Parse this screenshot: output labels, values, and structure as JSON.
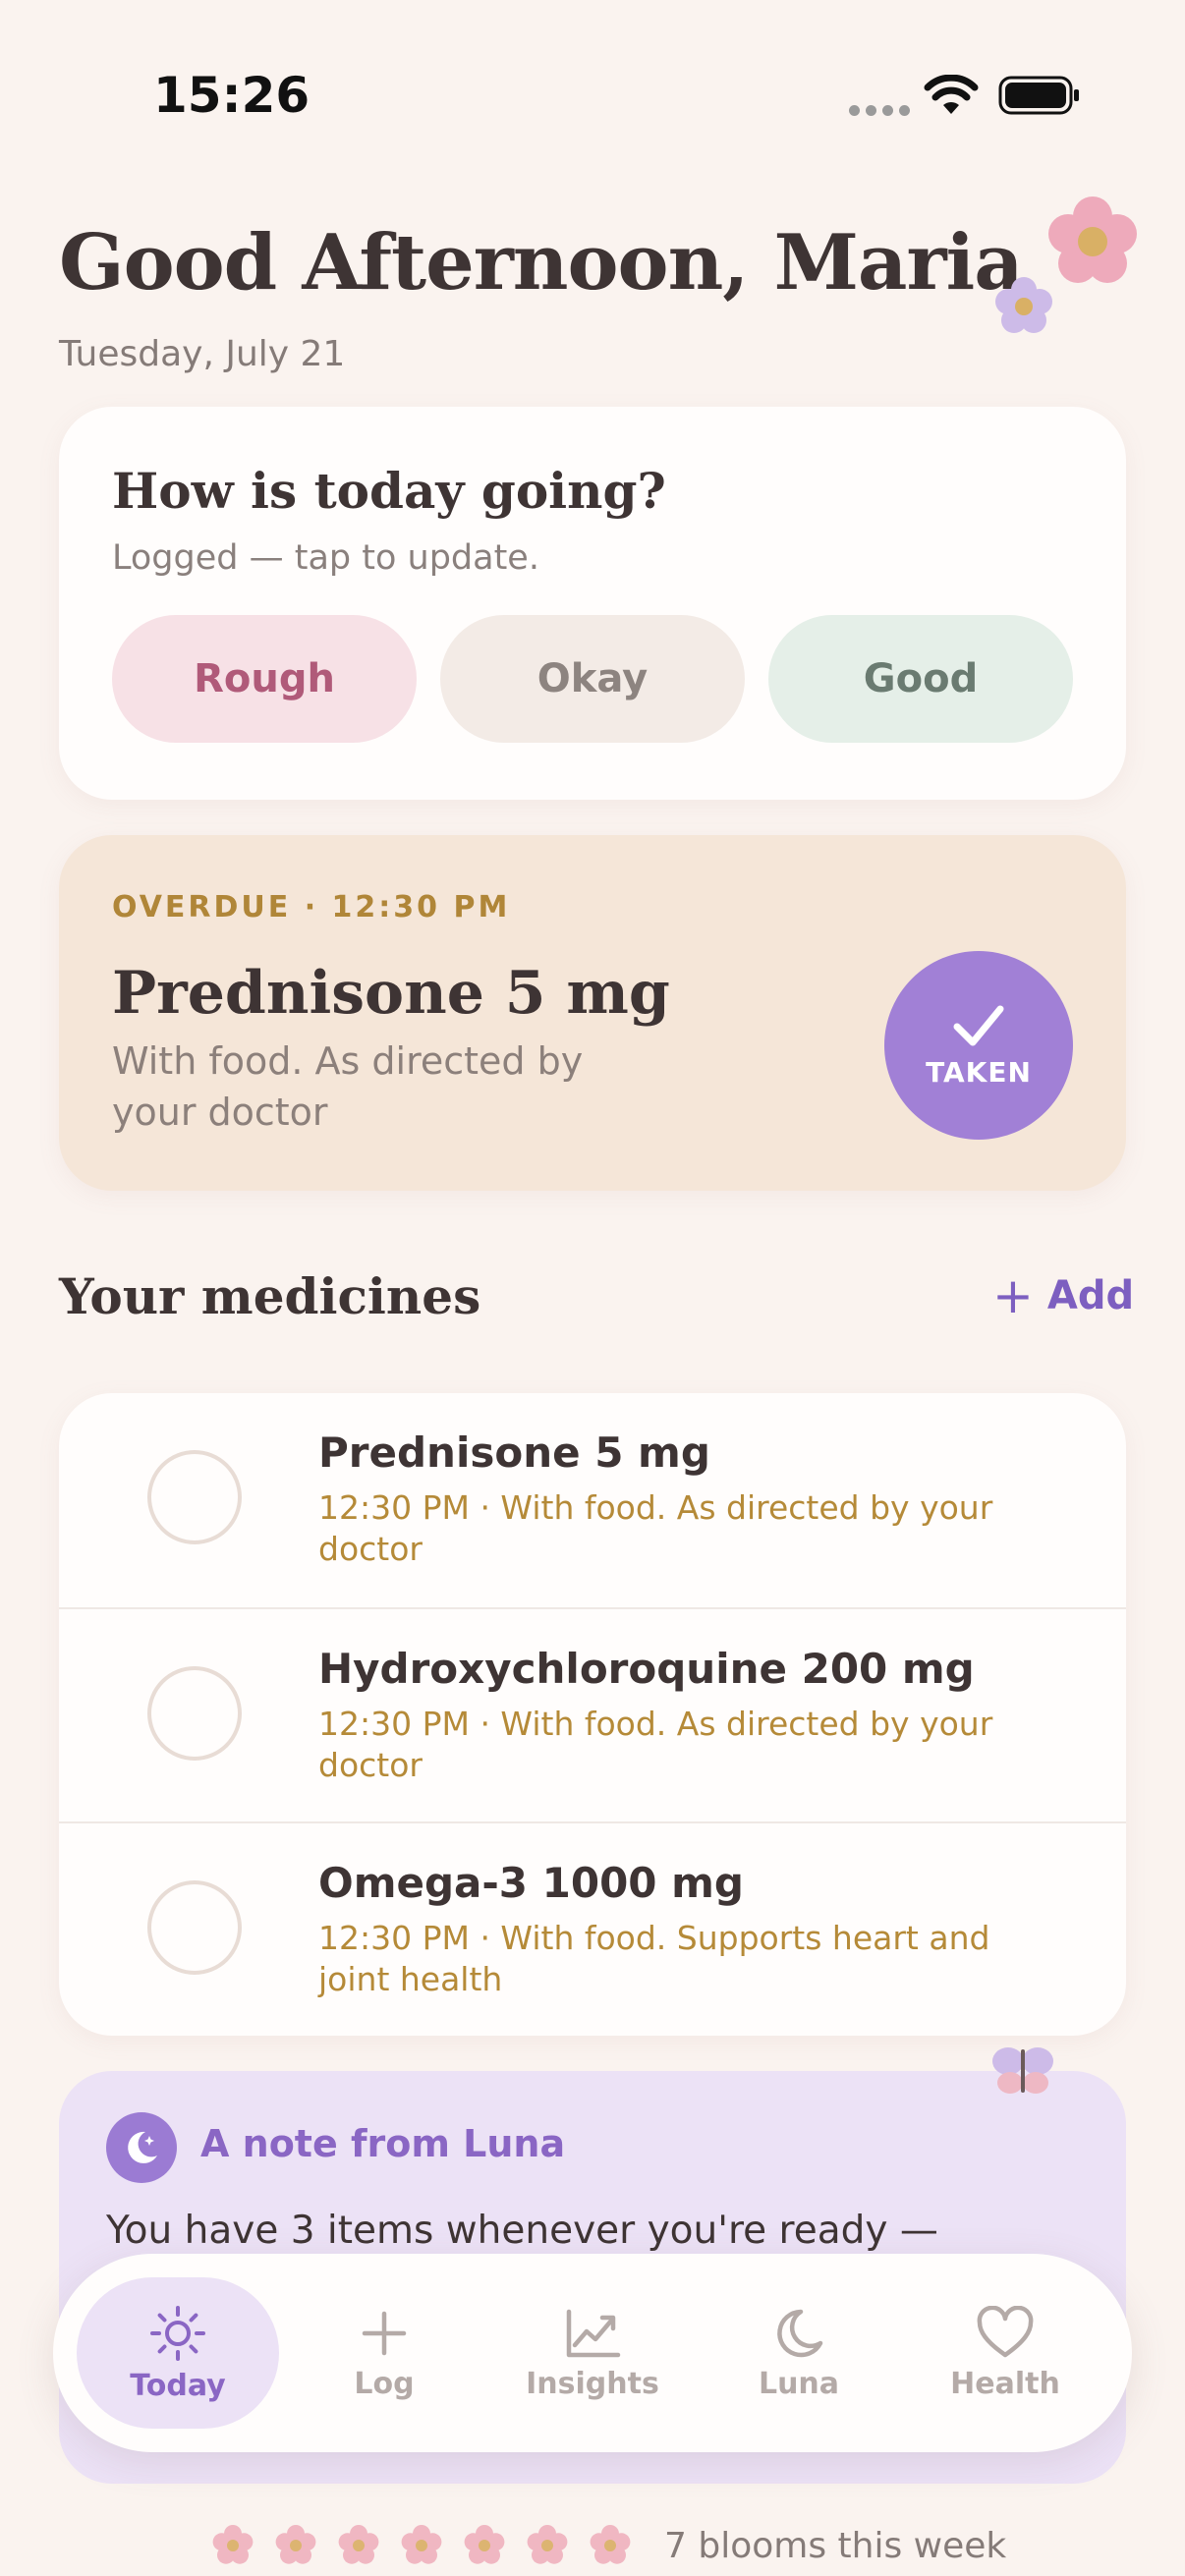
{
  "status_bar": {
    "time": "15:26"
  },
  "header": {
    "greeting": "Good Afternoon, Maria",
    "date": "Tuesday, July 21"
  },
  "mood": {
    "title": "How is today going?",
    "subtitle": "Logged — tap to update.",
    "options": [
      "Rough",
      "Okay",
      "Good"
    ]
  },
  "overdue": {
    "label": "OVERDUE · 12:30 PM",
    "name": "Prednisone 5 mg",
    "note": "With food. As directed by your doctor",
    "button_label": "TAKEN",
    "accent": "#a180d6"
  },
  "medicines_section": {
    "title": "Your medicines",
    "add_label": "Add",
    "items": [
      {
        "name": "Prednisone 5 mg",
        "detail": "12:30 PM · With food. As directed by your doctor"
      },
      {
        "name": "Hydroxychloroquine 200 mg",
        "detail": "12:30 PM · With food. As directed by your doctor"
      },
      {
        "name": "Omega-3 1000 mg",
        "detail": "12:30 PM · With food. Supports heart and joint health"
      }
    ]
  },
  "luna_note": {
    "title": "A note from Luna",
    "text": "You have 3 items whenever you're ready —"
  },
  "tabbar": {
    "tabs": [
      {
        "label": "Today",
        "icon": "sun-icon",
        "active": true
      },
      {
        "label": "Log",
        "icon": "plus-icon"
      },
      {
        "label": "Insights",
        "icon": "chart-icon"
      },
      {
        "label": "Luna",
        "icon": "moon-icon"
      },
      {
        "label": "Health",
        "icon": "heart-icon"
      }
    ]
  },
  "blooms": {
    "text": "7 blooms this week",
    "count": 7
  },
  "colors": {
    "background": "#faf3ef",
    "accent_purple": "#a180d6",
    "overdue_bg": "#f5e6d8",
    "gold_text": "#b58a38"
  }
}
